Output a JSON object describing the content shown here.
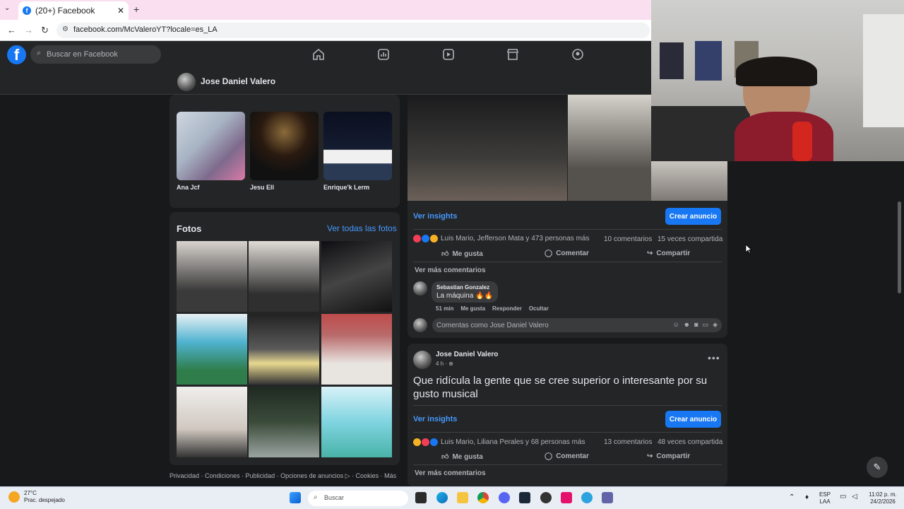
{
  "browser": {
    "tab_title": "(20+) Facebook",
    "url": "facebook.com/McValeroYT?locale=es_LA"
  },
  "fb": {
    "search_placeholder": "Buscar en Facebook",
    "brand_color": "#1877f2"
  },
  "profile": {
    "name": "Jose Daniel Valero"
  },
  "friends": {
    "items": [
      {
        "name": "Ana Jcf"
      },
      {
        "name": "Jesu Ell"
      },
      {
        "name": "Enrique'k Lerm"
      }
    ]
  },
  "photos": {
    "title": "Fotos",
    "see_all": "Ver todas las fotos"
  },
  "footer": {
    "text": "Privacidad · Condiciones · Publicidad · Opciones de anuncios ▷ · Cookies · Más"
  },
  "post1": {
    "insights": "Ver insights",
    "ad_button": "Crear anuncio",
    "reactions": "Luis Mario, Jefferson Mata y 473 personas más",
    "comments": "10 comentarios",
    "shares": "15 veces compartida",
    "like": "Me gusta",
    "comment": "Comentar",
    "share": "Compartir",
    "more_comments": "Ver más comentarios",
    "comment_author": "Sebastian Gonzalez",
    "comment_text": "La máquina 🔥🔥",
    "comment_time": "51 min",
    "comment_like": "Me gusta",
    "comment_reply": "Responder",
    "comment_hide": "Ocultar",
    "comment_box": "Comentas como Jose Daniel Valero"
  },
  "post2": {
    "author": "Jose Daniel Valero",
    "time": "4 h · ⊕",
    "text": "Que ridícula la gente que se cree superior o interesante por su gusto musical",
    "insights": "Ver insights",
    "ad_button": "Crear anuncio",
    "reactions": "Luis Mario, Liliana Perales y 68 personas más",
    "comments": "13 comentarios",
    "shares": "48 veces compartida",
    "like": "Me gusta",
    "comment": "Comentar",
    "share": "Compartir",
    "more_comments": "Ver más comentarios"
  },
  "taskbar": {
    "temp": "27°C",
    "weather": "Prac. despejado",
    "search": "Buscar",
    "lang1": "ESP",
    "lang2": "LAA",
    "time": "11:02 p. m.",
    "date": "24/2/2026"
  }
}
